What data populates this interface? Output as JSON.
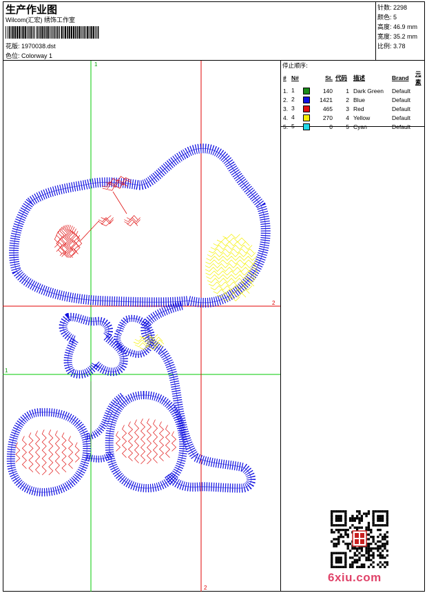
{
  "header": {
    "title": "生产作业图",
    "company": "Wilcom(汇宏) 绣饰工作室",
    "pattern_label": "花版:",
    "pattern_value": "1970038.dst",
    "colorway_label": "色位:",
    "colorway_value": "Colorway 1"
  },
  "specs": [
    {
      "label": "针数:",
      "value": "2298"
    },
    {
      "label": "颜色:",
      "value": "5"
    },
    {
      "label": "高度:",
      "value": "46.9 mm"
    },
    {
      "label": "宽度:",
      "value": "35.2 mm"
    },
    {
      "label": "比例:",
      "value": "3.78"
    }
  ],
  "stop_sequence": {
    "title": "停止顺序:",
    "headers": [
      "#",
      "N#",
      "St.",
      "代码",
      "描述",
      "Brand",
      "元素"
    ],
    "rows": [
      {
        "num": "1.",
        "n": "1",
        "color": "#1a8a1a",
        "st": "140",
        "code": "1",
        "desc": "Dark Green",
        "brand": "Default"
      },
      {
        "num": "2.",
        "n": "2",
        "color": "#1010e0",
        "st": "1421",
        "code": "2",
        "desc": "Blue",
        "brand": "Default"
      },
      {
        "num": "3.",
        "n": "3",
        "color": "#e01010",
        "st": "465",
        "code": "3",
        "desc": "Red",
        "brand": "Default"
      },
      {
        "num": "4.",
        "n": "4",
        "color": "#f5f000",
        "st": "270",
        "code": "4",
        "desc": "Yellow",
        "brand": "Default"
      },
      {
        "num": "5.",
        "n": "5",
        "color": "#20d8e8",
        "st": "0",
        "code": "5",
        "desc": "Cyan",
        "brand": "Default"
      }
    ]
  },
  "guides": {
    "green_top": "1",
    "green_left": "1",
    "red_right": "2",
    "red_bottom": "2"
  },
  "watermark": {
    "site": "6xiu.com"
  },
  "colors": {
    "guide_green": "#00c800",
    "guide_red": "#e00000",
    "blue_thread": "#1010e0",
    "red_thread": "#e01010",
    "yellow_thread": "#f5f000",
    "green_thread": "#1a8a1a"
  }
}
